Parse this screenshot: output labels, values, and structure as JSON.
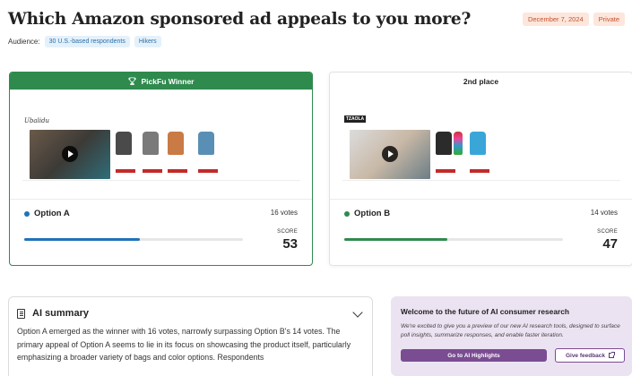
{
  "page": {
    "title": "Which Amazon sponsored ad appeals to you more?",
    "date_badge": "December 7, 2024",
    "privacy_badge": "Private"
  },
  "audience": {
    "label": "Audience:",
    "chips": [
      "30 U.S.-based respondents",
      "Hikers"
    ]
  },
  "options": [
    {
      "banner": "PickFu Winner",
      "name": "Option A",
      "votes": "16 votes",
      "score_label": "SCORE",
      "score": "53",
      "score_pct": 53,
      "dot_color": "#1f73b7",
      "bar_color": "#1f73b7",
      "preview_brand": "Ubalidu"
    },
    {
      "banner": "2nd place",
      "name": "Option B",
      "votes": "14 votes",
      "score_label": "SCORE",
      "score": "47",
      "score_pct": 47,
      "dot_color": "#2f8a4e",
      "bar_color": "#2f8a4e",
      "preview_brand": "TZAOLA"
    }
  ],
  "ai_summary": {
    "heading": "AI summary",
    "text": "Option A emerged as the winner with 16 votes, narrowly surpassing Option B's 14 votes. The primary appeal of Option A seems to lie in its focus on showcasing the product itself, particularly emphasizing a broader variety of bags and color options. Respondents"
  },
  "promo": {
    "title": "Welcome to the future of AI consumer research",
    "description": "We're excited to give you a preview of our new AI research tools, designed to surface poll insights, summarize responses, and enable faster iteration.",
    "primary_button": "Go to AI Highlights",
    "secondary_button": "Give feedback"
  },
  "colors": {
    "winner_green": "#2f8a4e",
    "promo_purple": "#7a4c92",
    "badge_orange": "#c2522e"
  }
}
